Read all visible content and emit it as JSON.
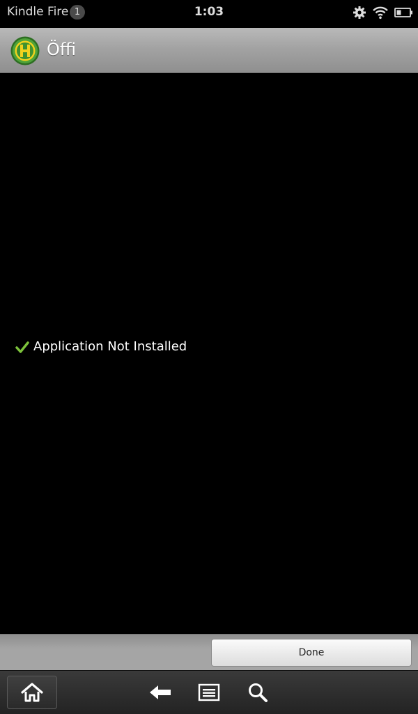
{
  "status_bar": {
    "device_name": "Kindle Fire",
    "notification_count": "1",
    "time": "1:03",
    "icons": [
      "gear-icon",
      "wifi-icon",
      "battery-icon"
    ]
  },
  "header": {
    "app_name": "Öffi",
    "app_icon": "offi-h-logo"
  },
  "main": {
    "status_icon": "check-icon",
    "status_message": "Application Not Installed"
  },
  "actions": {
    "done_label": "Done"
  },
  "nav": {
    "icons": [
      "home-icon",
      "back-arrow-icon",
      "menu-icon",
      "search-icon"
    ]
  },
  "colors": {
    "check": "#7cc23b",
    "logo_green": "#3c8c2c",
    "logo_yellow": "#f2d21e"
  }
}
